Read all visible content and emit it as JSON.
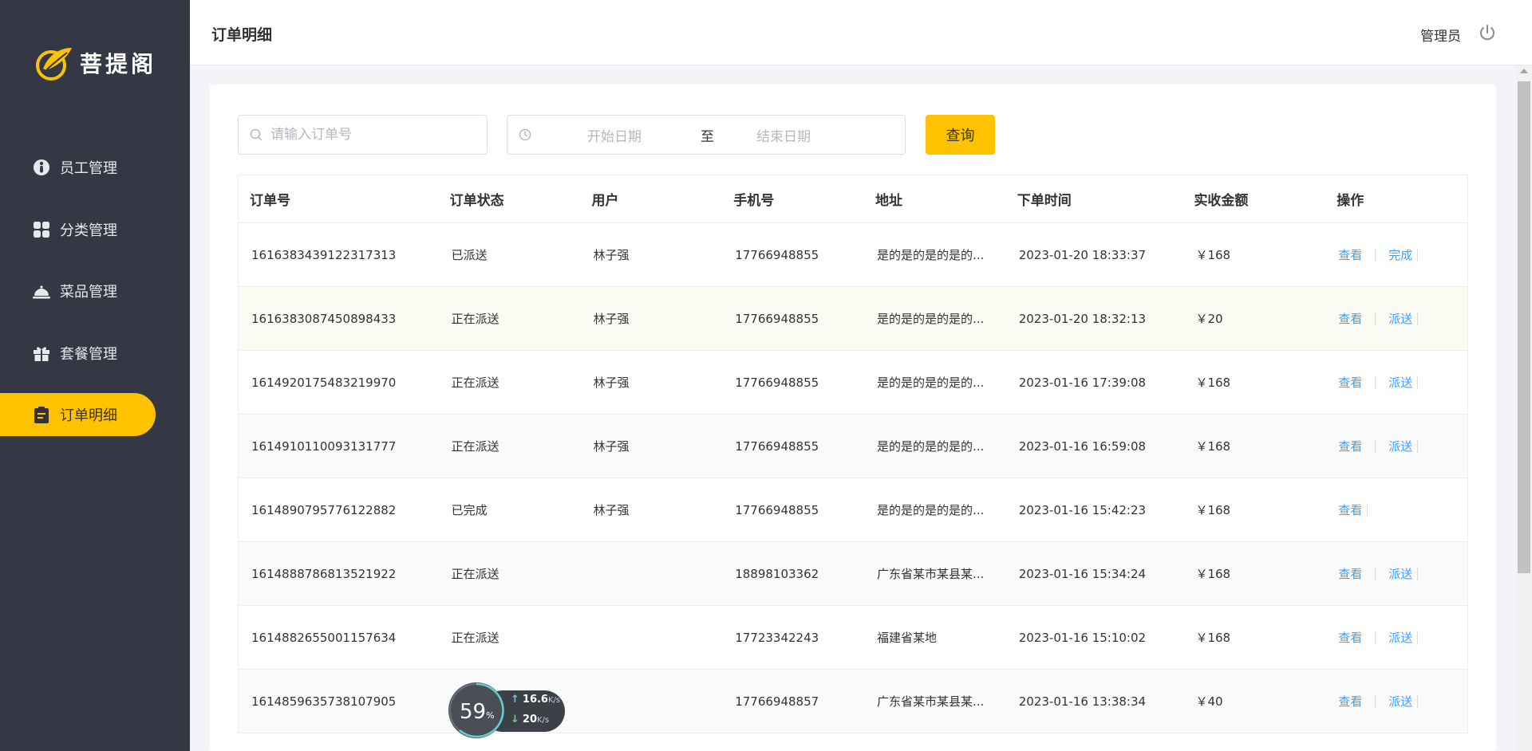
{
  "sidebar": {
    "logo_text": "菩提阁",
    "items": [
      {
        "label": "员工管理",
        "icon": "employee-icon"
      },
      {
        "label": "分类管理",
        "icon": "category-icon"
      },
      {
        "label": "菜品管理",
        "icon": "dish-icon"
      },
      {
        "label": "套餐管理",
        "icon": "combo-icon"
      },
      {
        "label": "订单明细",
        "icon": "order-icon",
        "active": true
      }
    ]
  },
  "header": {
    "title": "订单明细",
    "user": "管理员"
  },
  "filters": {
    "search_placeholder": "请输入订单号",
    "date_start_placeholder": "开始日期",
    "date_separator": "至",
    "date_end_placeholder": "结束日期",
    "query_label": "查询"
  },
  "table": {
    "columns": [
      "订单号",
      "订单状态",
      "用户",
      "手机号",
      "地址",
      "下单时间",
      "实收金额",
      "操作"
    ],
    "rows": [
      {
        "id": "1616383439122317313",
        "status": "已派送",
        "user": "林子强",
        "phone": "17766948855",
        "address": "是的是的是的是的...",
        "time": "2023-01-20 18:33:37",
        "amount": "￥168",
        "view": "查看",
        "action": "完成"
      },
      {
        "id": "1616383087450898433",
        "status": "正在派送",
        "user": "林子强",
        "phone": "17766948855",
        "address": "是的是的是的是的...",
        "time": "2023-01-20 18:32:13",
        "amount": "￥20",
        "view": "查看",
        "action": "派送"
      },
      {
        "id": "1614920175483219970",
        "status": "正在派送",
        "user": "林子强",
        "phone": "17766948855",
        "address": "是的是的是的是的...",
        "time": "2023-01-16 17:39:08",
        "amount": "￥168",
        "view": "查看",
        "action": "派送"
      },
      {
        "id": "1614910110093131777",
        "status": "正在派送",
        "user": "林子强",
        "phone": "17766948855",
        "address": "是的是的是的是的...",
        "time": "2023-01-16 16:59:08",
        "amount": "￥168",
        "view": "查看",
        "action": "派送"
      },
      {
        "id": "1614890795776122882",
        "status": "已完成",
        "user": "林子强",
        "phone": "17766948855",
        "address": "是的是的是的是的...",
        "time": "2023-01-16 15:42:23",
        "amount": "￥168",
        "view": "查看",
        "action": ""
      },
      {
        "id": "1614888786813521922",
        "status": "正在派送",
        "user": "",
        "phone": "18898103362",
        "address": "广东省某市某县某...",
        "time": "2023-01-16 15:34:24",
        "amount": "￥168",
        "view": "查看",
        "action": "派送"
      },
      {
        "id": "1614882655001157634",
        "status": "正在派送",
        "user": "",
        "phone": "17723342243",
        "address": "福建省某地",
        "time": "2023-01-16 15:10:02",
        "amount": "￥168",
        "view": "查看",
        "action": "派送"
      },
      {
        "id": "1614859635738107905",
        "status": "",
        "user": "",
        "phone": "17766948857",
        "address": "广东省某市某县某...",
        "time": "2023-01-16 13:38:34",
        "amount": "￥40",
        "view": "查看",
        "action": "派送"
      }
    ]
  },
  "net_widget": {
    "percent": "59",
    "percent_unit": "%",
    "up_speed": "16.6",
    "down_speed": "20",
    "speed_unit": "K/s"
  },
  "colors": {
    "sidebar_bg": "#343744",
    "accent": "#ffc200",
    "link": "#409eff"
  }
}
